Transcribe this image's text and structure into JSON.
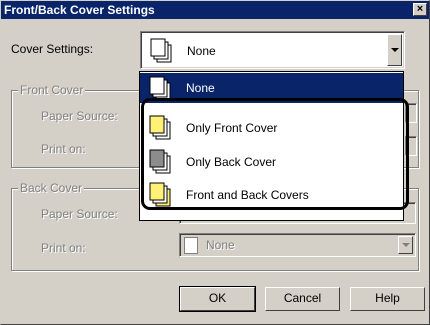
{
  "dialog": {
    "title": "Front/Back Cover Settings",
    "close_glyph": "×"
  },
  "cover_settings": {
    "label": "Cover Settings:",
    "value": "None"
  },
  "front_cover": {
    "group_label": "Front Cover",
    "paper_source_label": "Paper Source:",
    "print_on_label": "Print on:"
  },
  "back_cover": {
    "group_label": "Back Cover",
    "paper_source_label": "Paper Source:",
    "print_on_label": "Print on:",
    "print_on_value": "None"
  },
  "dropdown_list": {
    "items": [
      {
        "label": "None",
        "selected": true,
        "icon": "pages-none-icon"
      },
      {
        "label": "Only Front Cover",
        "selected": false,
        "icon": "pages-front-cover-icon"
      },
      {
        "label": "Only Back Cover",
        "selected": false,
        "icon": "pages-back-cover-icon"
      },
      {
        "label": "Front and Back Covers",
        "selected": false,
        "icon": "pages-front-back-covers-icon"
      }
    ]
  },
  "buttons": {
    "ok": "OK",
    "cancel": "Cancel",
    "help": "Help"
  },
  "colors": {
    "titlebar": "#0a246a",
    "face": "#d4d0c8",
    "cover_yellow": "#fff176",
    "cover_gray": "#8c8c8c"
  }
}
